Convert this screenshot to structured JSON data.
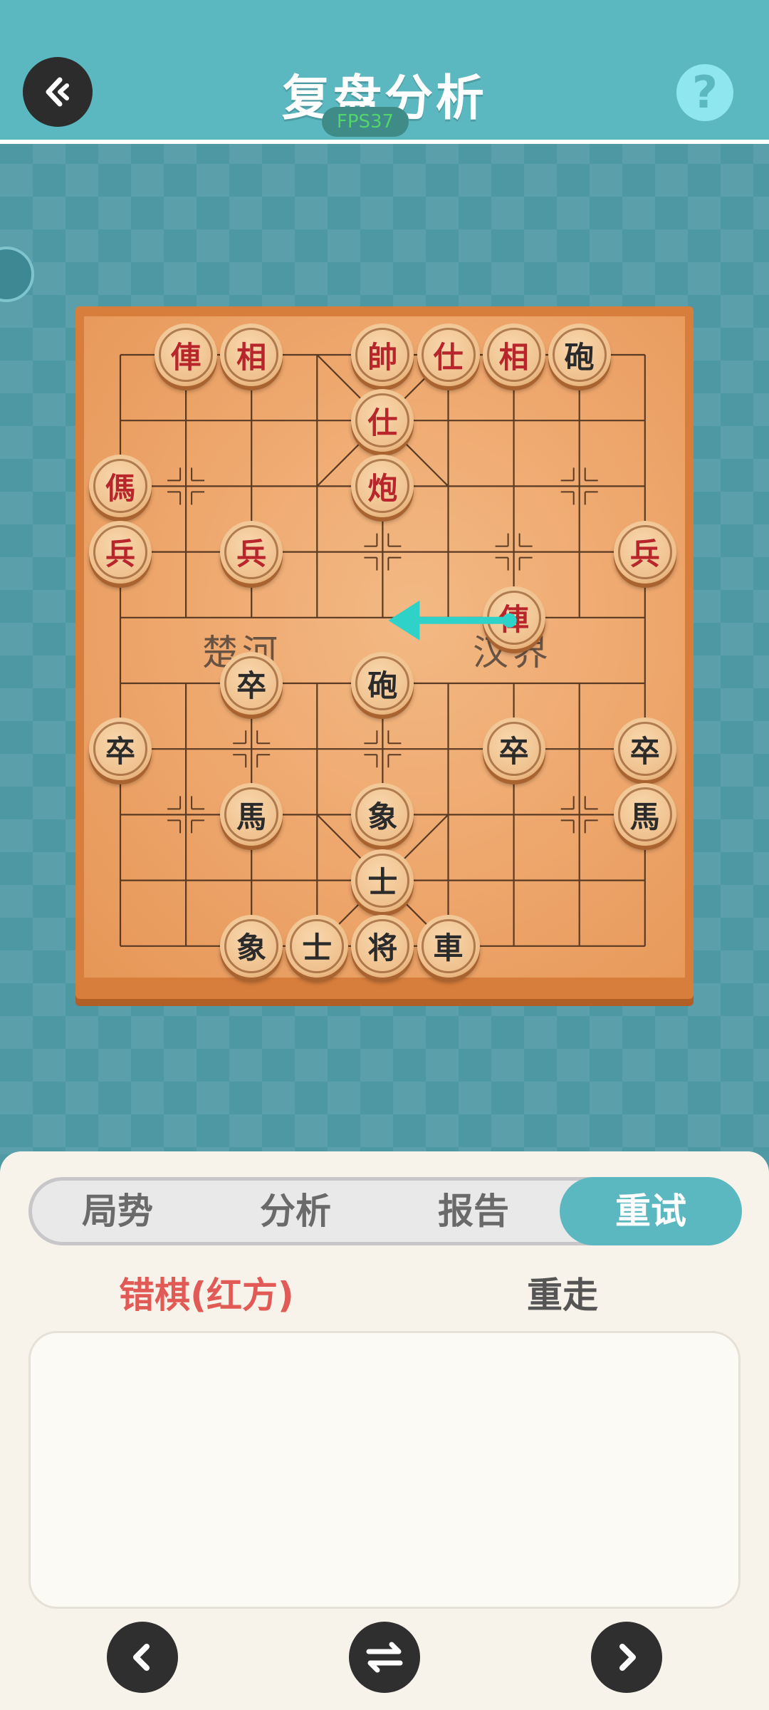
{
  "header": {
    "title": "复盘分析",
    "fps": "FPS37",
    "help_label": "?"
  },
  "board": {
    "river_left": "楚河",
    "river_right": "汉界",
    "last_move_arrow": {
      "from": [
        6,
        4
      ],
      "to": [
        4,
        4
      ],
      "color": "#2fd2c8"
    },
    "pieces": [
      {
        "char": "俥",
        "side": "red",
        "col": 1,
        "row": 0
      },
      {
        "char": "相",
        "side": "red",
        "col": 2,
        "row": 0
      },
      {
        "char": "帥",
        "side": "red",
        "col": 4,
        "row": 0
      },
      {
        "char": "仕",
        "side": "red",
        "col": 5,
        "row": 0
      },
      {
        "char": "相",
        "side": "red",
        "col": 6,
        "row": 0
      },
      {
        "char": "砲",
        "side": "black",
        "col": 7,
        "row": 0
      },
      {
        "char": "仕",
        "side": "red",
        "col": 4,
        "row": 1
      },
      {
        "char": "傌",
        "side": "red",
        "col": 0,
        "row": 2
      },
      {
        "char": "炮",
        "side": "red",
        "col": 4,
        "row": 2
      },
      {
        "char": "兵",
        "side": "red",
        "col": 0,
        "row": 3
      },
      {
        "char": "兵",
        "side": "red",
        "col": 2,
        "row": 3
      },
      {
        "char": "兵",
        "side": "red",
        "col": 8,
        "row": 3
      },
      {
        "char": "俥",
        "side": "red",
        "col": 6,
        "row": 4
      },
      {
        "char": "卒",
        "side": "black",
        "col": 2,
        "row": 5
      },
      {
        "char": "砲",
        "side": "black",
        "col": 4,
        "row": 5
      },
      {
        "char": "卒",
        "side": "black",
        "col": 0,
        "row": 6
      },
      {
        "char": "卒",
        "side": "black",
        "col": 6,
        "row": 6
      },
      {
        "char": "卒",
        "side": "black",
        "col": 8,
        "row": 6
      },
      {
        "char": "馬",
        "side": "black",
        "col": 2,
        "row": 7
      },
      {
        "char": "象",
        "side": "black",
        "col": 4,
        "row": 7
      },
      {
        "char": "馬",
        "side": "black",
        "col": 8,
        "row": 7
      },
      {
        "char": "士",
        "side": "black",
        "col": 4,
        "row": 8
      },
      {
        "char": "象",
        "side": "black",
        "col": 2,
        "row": 9
      },
      {
        "char": "士",
        "side": "black",
        "col": 3,
        "row": 9
      },
      {
        "char": "将",
        "side": "black",
        "col": 4,
        "row": 9
      },
      {
        "char": "車",
        "side": "black",
        "col": 5,
        "row": 9
      }
    ]
  },
  "tabs": [
    {
      "label": "局势",
      "active": false
    },
    {
      "label": "分析",
      "active": false
    },
    {
      "label": "报告",
      "active": false
    },
    {
      "label": "重试",
      "active": true
    }
  ],
  "subheader": {
    "left": "错棋(红方)",
    "right": "重走"
  },
  "colors": {
    "accent": "#5cb8c0",
    "red_piece": "#b8262b",
    "black_piece": "#2b2b2b",
    "error_text": "#e15a55"
  },
  "controls": {
    "prev_icon": "chevron-left-icon",
    "swap_icon": "swap-arrows-icon",
    "next_icon": "chevron-right-icon"
  }
}
